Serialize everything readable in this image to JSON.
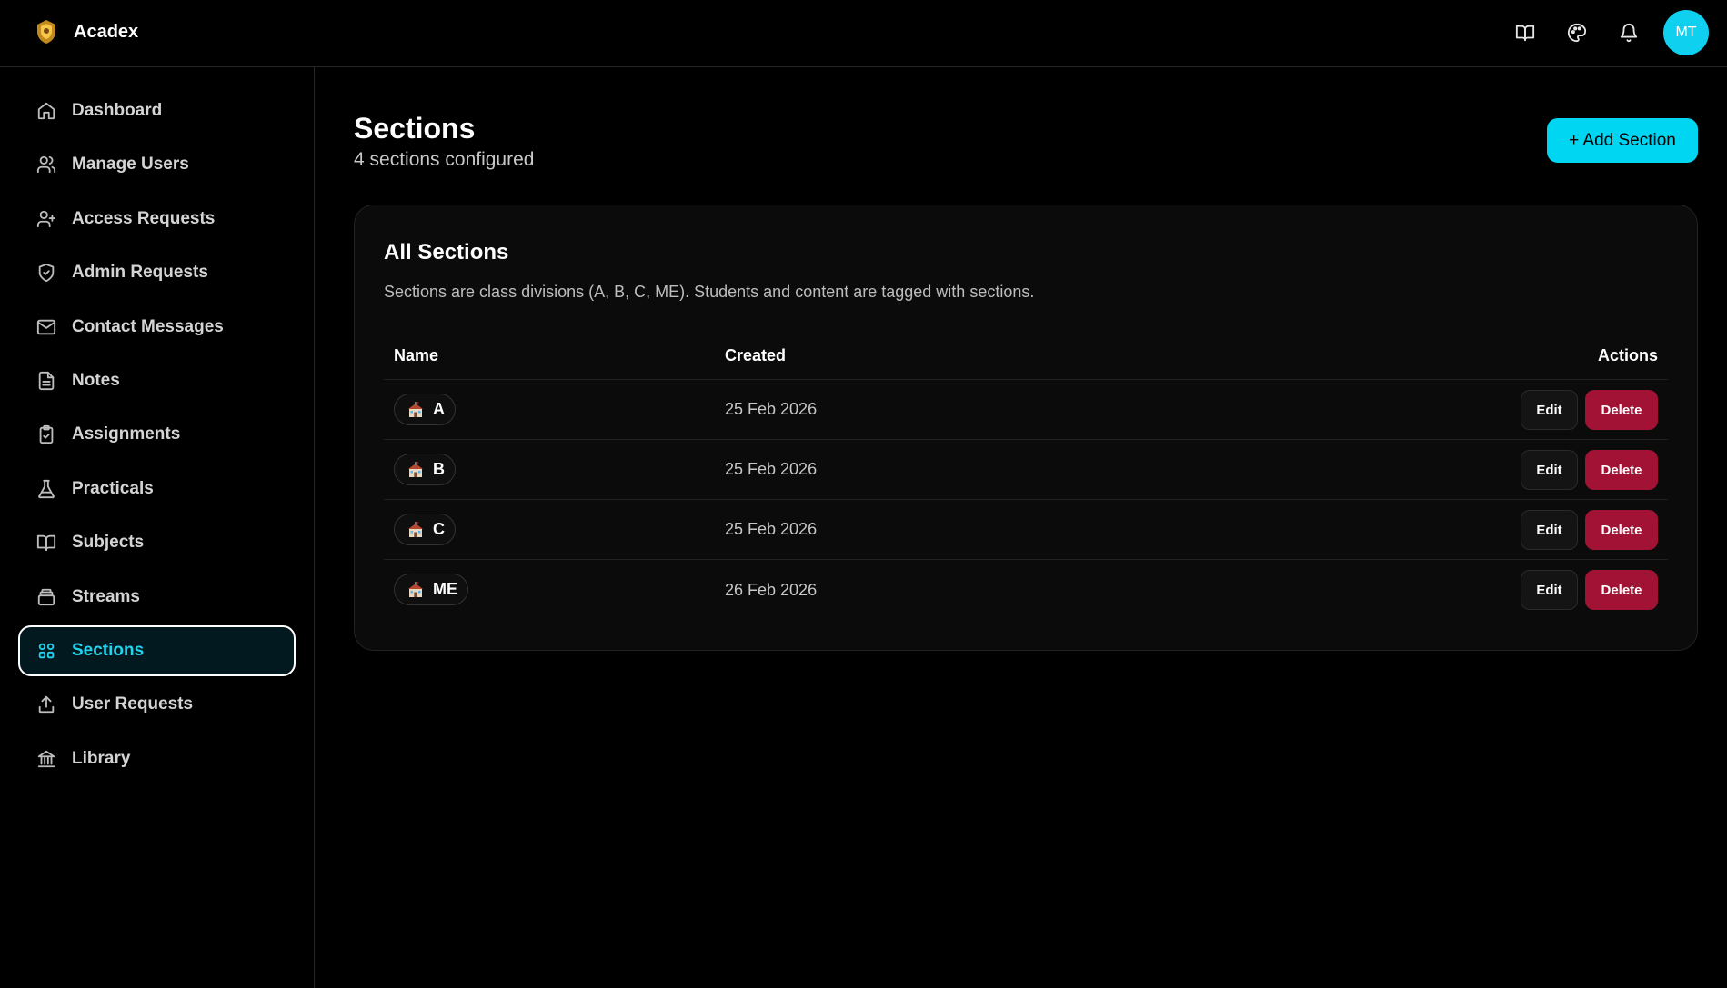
{
  "app": {
    "name": "Acadex"
  },
  "header": {
    "icons": [
      "book-open-icon",
      "palette-icon",
      "bell-icon"
    ],
    "avatar_initials": "MT",
    "avatar_color": "#0fd0ee"
  },
  "sidebar": {
    "items": [
      {
        "label": "Dashboard",
        "icon": "home-icon"
      },
      {
        "label": "Manage Users",
        "icon": "users-icon"
      },
      {
        "label": "Access Requests",
        "icon": "user-plus-icon"
      },
      {
        "label": "Admin Requests",
        "icon": "shield-icon"
      },
      {
        "label": "Contact Messages",
        "icon": "mail-icon"
      },
      {
        "label": "Notes",
        "icon": "file-text-icon"
      },
      {
        "label": "Assignments",
        "icon": "clipboard-check-icon"
      },
      {
        "label": "Practicals",
        "icon": "flask-icon"
      },
      {
        "label": "Subjects",
        "icon": "book-icon"
      },
      {
        "label": "Streams",
        "icon": "layers-icon"
      },
      {
        "label": "Sections",
        "icon": "grid-icon",
        "active": true
      },
      {
        "label": "User Requests",
        "icon": "upload-icon"
      },
      {
        "label": "Library",
        "icon": "library-icon"
      }
    ],
    "active_color": "#22d3ee"
  },
  "main": {
    "title": "Sections",
    "subtitle": "4 sections configured",
    "add_button_label": "+ Add Section",
    "accent_color": "#00d6f2"
  },
  "card": {
    "title": "All Sections",
    "description": "Sections are class divisions (A, B, C, ME). Students and content are tagged with sections.",
    "columns": {
      "name": "Name",
      "created": "Created",
      "actions": "Actions"
    },
    "rows": [
      {
        "name": "A",
        "created": "25 Feb 2026"
      },
      {
        "name": "B",
        "created": "25 Feb 2026"
      },
      {
        "name": "C",
        "created": "25 Feb 2026"
      },
      {
        "name": "ME",
        "created": "26 Feb 2026"
      }
    ],
    "edit_label": "Edit",
    "delete_label": "Delete",
    "delete_color": "#a11234"
  }
}
